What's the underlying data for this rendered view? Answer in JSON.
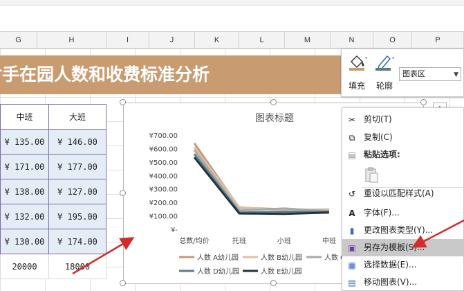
{
  "columns": [
    "G",
    "H",
    "I",
    "J",
    "K",
    "L",
    "M",
    "N",
    "O",
    "P"
  ],
  "sheet_title": "对手在园人数和收费标准分析",
  "table": {
    "headers": [
      "中班",
      "大班"
    ],
    "rows": [
      [
        "¥ 135.00",
        "¥ 146.00"
      ],
      [
        "¥ 171.00",
        "¥ 177.00"
      ],
      [
        "¥ 138.00",
        "¥ 127.00"
      ],
      [
        "¥ 132.00",
        "¥ 195.00"
      ],
      [
        "¥ 130.00",
        "¥ 174.00"
      ]
    ],
    "extra_rows": [
      [
        "20000",
        "18000"
      ]
    ]
  },
  "format_panel": {
    "fill_label": "填充",
    "outline_label": "轮廓",
    "element_select": "图表区"
  },
  "chart_data": {
    "type": "line",
    "title": "图表标题",
    "categories": [
      "总数/均价",
      "托班",
      "小班",
      "中班"
    ],
    "ylim": [
      0,
      700
    ],
    "yticks": [
      "¥-",
      "¥100.00",
      "¥200.00",
      "¥300.00",
      "¥400.00",
      "¥500.00",
      "¥600.00",
      "¥700.00"
    ],
    "series": [
      {
        "name": "人数 A幼儿园",
        "color": "#c29a74",
        "values": [
          640,
          160,
          150,
          140
        ]
      },
      {
        "name": "人数 B幼儿园",
        "color": "#dcc0ab",
        "values": [
          610,
          165,
          140,
          150
        ]
      },
      {
        "name": "人数 C幼儿园",
        "color": "#a8a8a8",
        "values": [
          590,
          140,
          155,
          135
        ]
      },
      {
        "name": "人数 D幼儿园",
        "color": "#5b7b84",
        "values": [
          560,
          125,
          130,
          130
        ]
      },
      {
        "name": "人数 E幼儿园",
        "color": "#22333e",
        "values": [
          535,
          118,
          115,
          125
        ]
      }
    ],
    "legend_visible": [
      "人数 A幼儿园",
      "人数 B幼儿园",
      "人数 C幼儿园",
      "人数 D幼儿园",
      "人数 E幼儿园"
    ]
  },
  "context_menu": {
    "items": [
      {
        "icon": "scissors-icon",
        "glyph": "✂",
        "label": "剪切(T)"
      },
      {
        "icon": "copy-icon",
        "glyph": "⧉",
        "label": "复制(C)"
      },
      {
        "icon": "paste-icon",
        "glyph": "📋",
        "label": "粘贴选项:"
      },
      {
        "icon": "reset-style-icon",
        "glyph": "↺",
        "label": "重设以匹配样式(A)"
      },
      {
        "icon": "font-icon",
        "glyph": "A",
        "label": "字体(F)..."
      },
      {
        "icon": "chart-type-icon",
        "glyph": "▮",
        "label": "更改图表类型(Y)..."
      },
      {
        "icon": "save-template-icon",
        "glyph": "▣",
        "label": "另存为模板(S)..."
      },
      {
        "icon": "select-data-icon",
        "glyph": "▦",
        "label": "选择数据(E)..."
      },
      {
        "icon": "move-chart-icon",
        "glyph": "▤",
        "label": "移动图表(V)..."
      }
    ]
  },
  "colors": {
    "title_band": "#c99b70",
    "arrow": "#d42b2b",
    "table_fill": "#e4ecf6",
    "table_border": "#7e6aa6"
  }
}
